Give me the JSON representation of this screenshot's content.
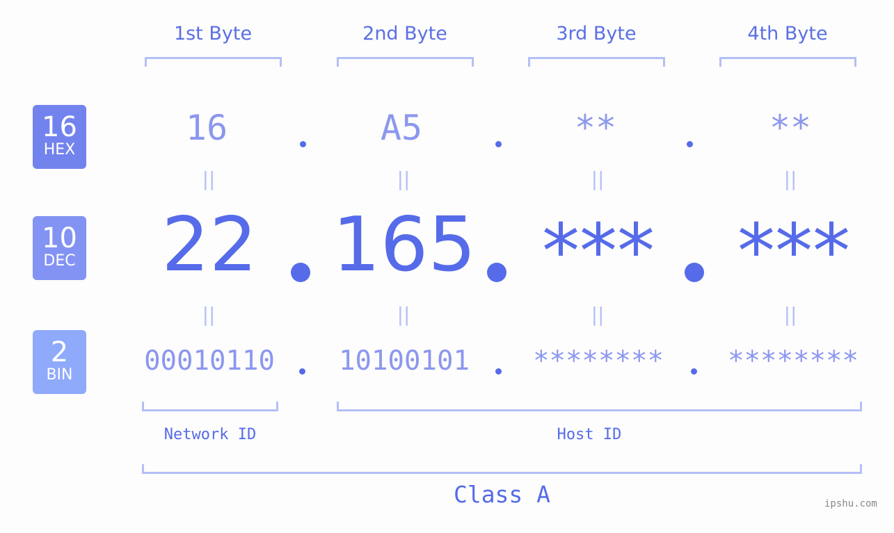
{
  "bytes": [
    {
      "header": "1st Byte",
      "hex": "16",
      "dec": "22",
      "bin": "00010110"
    },
    {
      "header": "2nd Byte",
      "hex": "A5",
      "dec": "165",
      "bin": "10100101"
    },
    {
      "header": "3rd Byte",
      "hex": "**",
      "dec": "***",
      "bin": "********"
    },
    {
      "header": "4th Byte",
      "hex": "**",
      "dec": "***",
      "bin": "********"
    }
  ],
  "badges": {
    "hex": {
      "num": "16",
      "label": "HEX",
      "color": "#7383ed"
    },
    "dec": {
      "num": "10",
      "label": "DEC",
      "color": "#8393f3"
    },
    "bin": {
      "num": "2",
      "label": "BIN",
      "color": "#8fa9fb"
    }
  },
  "equals_sign": "||",
  "network_id_label": "Network ID",
  "host_id_label": "Host ID",
  "class_label": "Class A",
  "watermark": "ipshu.com"
}
